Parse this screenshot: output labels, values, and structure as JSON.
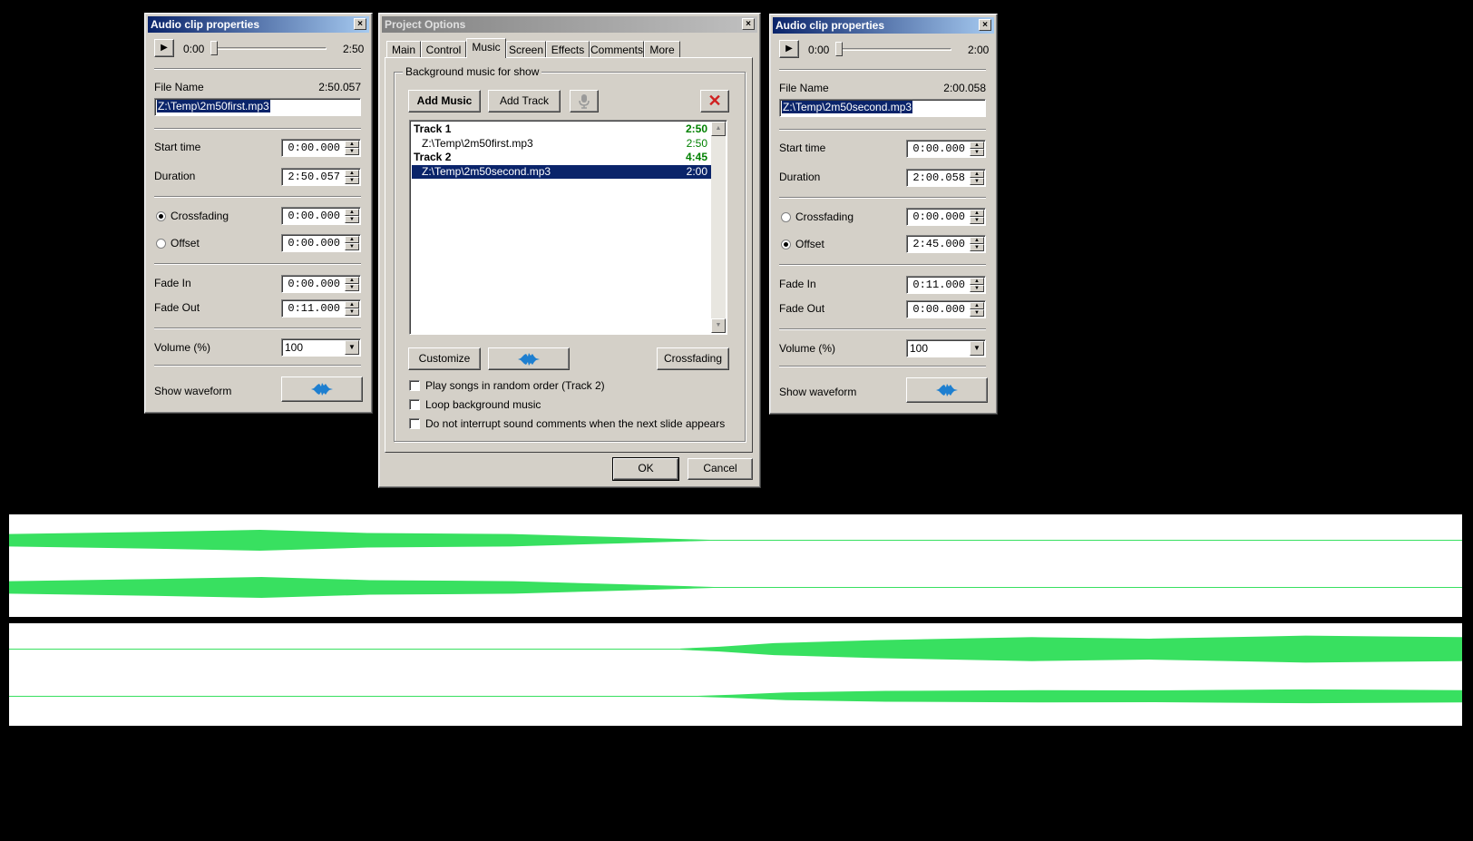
{
  "clip1": {
    "title": "Audio clip properties",
    "close_glyph": "×",
    "play_glyph": "▶",
    "pos_start": "0:00",
    "pos_end": "2:50",
    "file_name_label": "File Name",
    "file_duration": "2:50.057",
    "file_path": "Z:\\Temp\\2m50first.mp3",
    "start_time_label": "Start time",
    "start_time": "0:00.000",
    "duration_label": "Duration",
    "duration": "2:50.057",
    "crossfading_label": "Crossfading",
    "crossfading": "0:00.000",
    "crossfading_selected": true,
    "offset_label": "Offset",
    "offset": "0:00.000",
    "offset_selected": false,
    "fade_in_label": "Fade In",
    "fade_in": "0:00.000",
    "fade_out_label": "Fade Out",
    "fade_out": "0:11.000",
    "volume_label": "Volume (%)",
    "volume": "100",
    "show_waveform_label": "Show waveform",
    "waveform_icon": "waveform-icon"
  },
  "project": {
    "title": "Project Options",
    "close_glyph": "×",
    "tabs": [
      "Main",
      "Control",
      "Music",
      "Screen",
      "Effects",
      "Comments",
      "More"
    ],
    "active_tab": "Music",
    "group_label": "Background music for show",
    "add_music": "Add Music",
    "add_track": "Add Track",
    "mic_icon": "microphone-icon",
    "delete_glyph": "✕",
    "list": [
      {
        "label": "Track 1",
        "duration": "2:50",
        "kind": "track"
      },
      {
        "label": "Z:\\Temp\\2m50first.mp3",
        "duration": "2:50",
        "kind": "file"
      },
      {
        "label": "Track 2",
        "duration": "4:45",
        "kind": "track"
      },
      {
        "label": "Z:\\Temp\\2m50second.mp3",
        "duration": "2:00",
        "kind": "file-selected"
      }
    ],
    "customize": "Customize",
    "crossfading": "Crossfading",
    "options": [
      {
        "label": "Play songs in random order (Track 2)",
        "checked": false
      },
      {
        "label": "Loop background music",
        "checked": false
      },
      {
        "label": "Do not interrupt sound comments when the next slide appears",
        "checked": false
      }
    ],
    "ok": "OK",
    "cancel": "Cancel"
  },
  "clip2": {
    "title": "Audio clip properties",
    "close_glyph": "×",
    "play_glyph": "▶",
    "pos_start": "0:00",
    "pos_end": "2:00",
    "file_name_label": "File Name",
    "file_duration": "2:00.058",
    "file_path": "Z:\\Temp\\2m50second.mp3",
    "start_time_label": "Start time",
    "start_time": "0:00.000",
    "duration_label": "Duration",
    "duration": "2:00.058",
    "crossfading_label": "Crossfading",
    "crossfading": "0:00.000",
    "crossfading_selected": false,
    "offset_label": "Offset",
    "offset": "2:45.000",
    "offset_selected": true,
    "fade_in_label": "Fade In",
    "fade_in": "0:11.000",
    "fade_out_label": "Fade Out",
    "fade_out": "0:00.000",
    "volume_label": "Volume (%)",
    "volume": "100",
    "show_waveform_label": "Show waveform",
    "waveform_icon": "waveform-icon"
  },
  "colors": {
    "waveform": "#38e060",
    "title_active": "#0a246a",
    "selection": "#0a246a",
    "duration_text": "#008000",
    "delete_icon": "#d02020",
    "waveform_icon": "#1e7fd0"
  }
}
